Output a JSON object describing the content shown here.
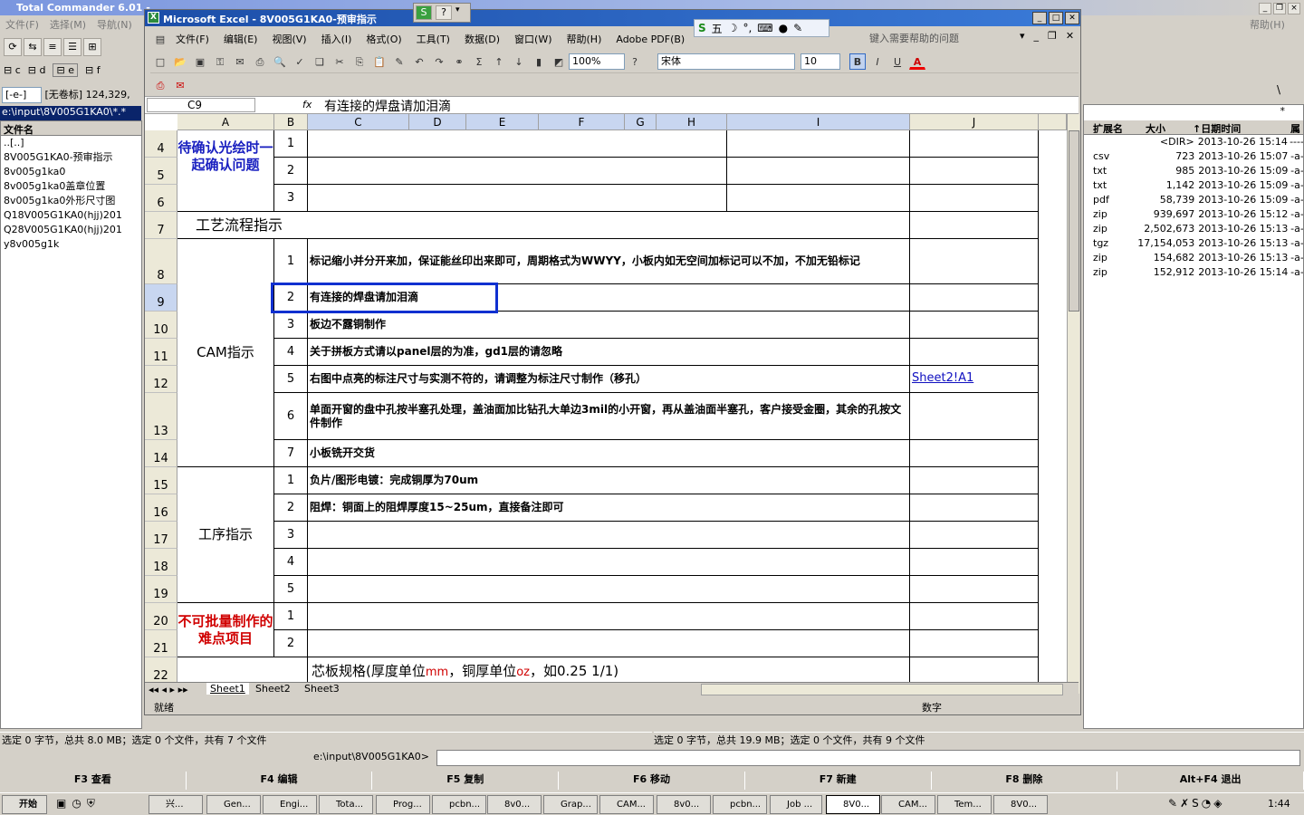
{
  "tc": {
    "title": "Total Commander 6.01 - ",
    "menu": [
      "文件(F)",
      "选择(M)",
      "导航(N)"
    ],
    "help": "帮助(H)",
    "drives": [
      "c",
      "d",
      "e",
      "f"
    ],
    "drivecombo": "[-e-]",
    "drivelabel": "[无卷标]",
    "drivefree": "124,329,",
    "path_left": "e:\\input\\8V005G1KA0\\*.*",
    "left_header": "文件名",
    "left_files": [
      "..[..]",
      "8V005G1KA0-预审指示",
      "8v005g1ka0",
      "8v005g1ka0盖章位置",
      "8v005g1ka0外形尺寸图",
      "Q18V005G1KA0(hjj)201",
      "Q28V005G1KA0(hjj)201",
      "y8v005g1k"
    ],
    "right_headers": [
      "扩展名",
      "大小",
      "↑日期时间",
      "属"
    ],
    "right_files": [
      {
        "ext": "",
        "size": "<DIR>",
        "date": "2013-10-26 15:14",
        "attr": "----"
      },
      {
        "ext": "csv",
        "size": "723",
        "date": "2013-10-26 15:07",
        "attr": "-a-"
      },
      {
        "ext": "txt",
        "size": "985",
        "date": "2013-10-26 15:09",
        "attr": "-a-"
      },
      {
        "ext": "txt",
        "size": "1,142",
        "date": "2013-10-26 15:09",
        "attr": "-a-"
      },
      {
        "ext": "pdf",
        "size": "58,739",
        "date": "2013-10-26 15:09",
        "attr": "-a-"
      },
      {
        "ext": "zip",
        "size": "939,697",
        "date": "2013-10-26 15:12",
        "attr": "-a-"
      },
      {
        "ext": "zip",
        "size": "2,502,673",
        "date": "2013-10-26 15:13",
        "attr": "-a-"
      },
      {
        "ext": "tgz",
        "size": "17,154,053",
        "date": "2013-10-26 15:13",
        "attr": "-a-"
      },
      {
        "ext": "zip",
        "size": "154,682",
        "date": "2013-10-26 15:13",
        "attr": "-a-"
      },
      {
        "ext": "zip",
        "size": "152,912",
        "date": "2013-10-26 15:14",
        "attr": "-a-"
      }
    ],
    "status_left": "选定 0 字节，总共 8.0 MB；选定 0 个文件，共有 7 个文件",
    "status_right": "选定 0 字节，总共 19.9 MB；选定 0 个文件，共有 9 个文件",
    "cmd_path": "e:\\input\\8V005G1KA0>",
    "fkeys": [
      "F3 查看",
      "F4 编辑",
      "F5 复制",
      "F6 移动",
      "F7 新建",
      "F8 删除",
      "Alt+F4 退出"
    ]
  },
  "excel": {
    "title": "Microsoft Excel - 8V005G1KA0-预审指示",
    "menu": [
      "文件(F)",
      "编辑(E)",
      "视图(V)",
      "插入(I)",
      "格式(O)",
      "工具(T)",
      "数据(D)",
      "窗口(W)",
      "帮助(H)",
      "Adobe PDF(B)"
    ],
    "help_placeholder": "键入需要帮助的问题",
    "zoom": "100%",
    "font": "宋体",
    "size": "10",
    "namebox": "C9",
    "fx": "fx",
    "formula": "有连接的焊盘请加泪滴",
    "cols": [
      "A",
      "B",
      "C",
      "D",
      "E",
      "F",
      "G",
      "H",
      "I",
      "J"
    ],
    "rows": [
      "4",
      "5",
      "6",
      "7",
      "8",
      "9",
      "10",
      "11",
      "12",
      "13",
      "14",
      "15",
      "16",
      "17",
      "18",
      "19",
      "20",
      "21",
      "22"
    ],
    "sect_confirm": "待确认光绘时一起确认问题",
    "sect_process": "工艺流程指示",
    "sect_cam": "CAM指示",
    "sect_step": "工序指示",
    "sect_hard": "不可批量制作的难点项目",
    "cam": [
      {
        "n": "1",
        "t": "标记缩小并分开来加，保证能丝印出来即可，周期格式为WWYY，小板内如无空间加标记可以不加，不加无铅标记"
      },
      {
        "n": "2",
        "t": "有连接的焊盘请加泪滴"
      },
      {
        "n": "3",
        "t": "板边不露铜制作"
      },
      {
        "n": "4",
        "t": "关于拼板方式请以panel层的为准，gd1层的请忽略"
      },
      {
        "n": "5",
        "t": "右图中点亮的标注尺寸与实测不符的，请调整为标注尺寸制作（移孔）"
      },
      {
        "n": "6",
        "t": "单面开窗的盘中孔按半塞孔处理，盖油面加比钻孔大单边3mil的小开窗，再从盖油面半塞孔，客户接受金圈，其余的孔按文件制作"
      },
      {
        "n": "7",
        "t": "小板铣开交货"
      }
    ],
    "link": "Sheet2!A1",
    "steps": [
      {
        "n": "1",
        "t": "负片/图形电镀：完成铜厚为70um"
      },
      {
        "n": "2",
        "t": "阻焊：铜面上的阻焊厚度15~25um，直接备注即可"
      },
      {
        "n": "3",
        "t": ""
      },
      {
        "n": "4",
        "t": ""
      },
      {
        "n": "5",
        "t": ""
      }
    ],
    "confirm_nums": [
      "1",
      "2",
      "3"
    ],
    "hard_nums": [
      "1",
      "2"
    ],
    "row22_a": "芯板规格(厚度单位",
    "row22_b": "mm",
    "row22_c": "，铜厚单位",
    "row22_d": "oz",
    "row22_e": "，如0.25 1/1)",
    "sheets": [
      "Sheet1",
      "Sheet2",
      "Sheet3"
    ],
    "status": "就绪",
    "status_num": "数字"
  },
  "taskbar": {
    "start": "开始",
    "tasks": [
      "兴...",
      "Gen...",
      "Engi...",
      "Tota...",
      "Prog...",
      "pcbn...",
      "8v0...",
      "Grap...",
      "CAM...",
      "8v0...",
      "pcbn...",
      "Job ...",
      "8V0...",
      "CAM...",
      "Tem...",
      "8V0..."
    ],
    "clock": "1:44"
  },
  "ime": {
    "label": "五"
  }
}
